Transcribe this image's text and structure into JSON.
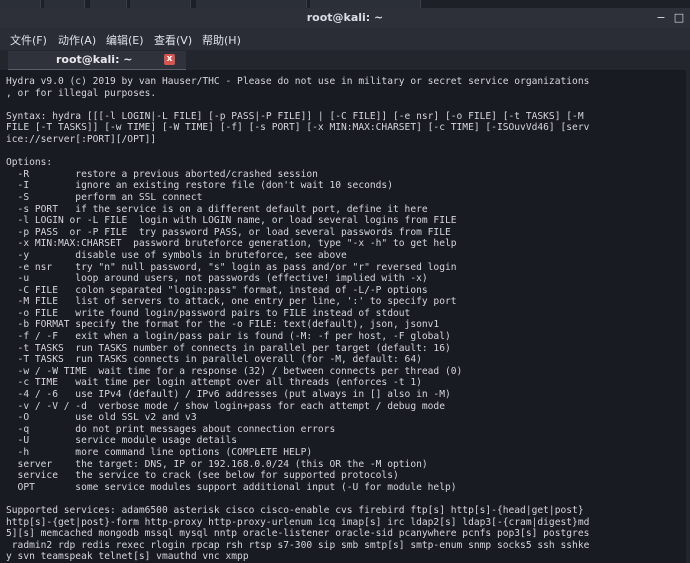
{
  "window": {
    "title": "root@kali: ~",
    "minimize_glyph": "−",
    "maximize_glyph": "□"
  },
  "menu": {
    "file": "文件(F)",
    "actions": "动作(A)",
    "edit": "编辑(E)",
    "view": "查看(V)",
    "help": "帮助(H)"
  },
  "tab": {
    "label": "root@kali: ~",
    "close_glyph": "x"
  },
  "terminal": {
    "text": "Hydra v9.0 (c) 2019 by van Hauser/THC - Please do not use in military or secret service organizations\n, or for illegal purposes.\n\nSyntax: hydra [[[-l LOGIN|-L FILE] [-p PASS|-P FILE]] | [-C FILE]] [-e nsr] [-o FILE] [-t TASKS] [-M\nFILE [-T TASKS]] [-w TIME] [-W TIME] [-f] [-s PORT] [-x MIN:MAX:CHARSET] [-c TIME] [-ISOuvVd46] [serv\nice://server[:PORT][/OPT]]\n\nOptions:\n  -R        restore a previous aborted/crashed session\n  -I        ignore an existing restore file (don't wait 10 seconds)\n  -S        perform an SSL connect\n  -s PORT   if the service is on a different default port, define it here\n  -l LOGIN or -L FILE  login with LOGIN name, or load several logins from FILE\n  -p PASS  or -P FILE  try password PASS, or load several passwords from FILE\n  -x MIN:MAX:CHARSET  password bruteforce generation, type \"-x -h\" to get help\n  -y        disable use of symbols in bruteforce, see above\n  -e nsr    try \"n\" null password, \"s\" login as pass and/or \"r\" reversed login\n  -u        loop around users, not passwords (effective! implied with -x)\n  -C FILE   colon separated \"login:pass\" format, instead of -L/-P options\n  -M FILE   list of servers to attack, one entry per line, ':' to specify port\n  -o FILE   write found login/password pairs to FILE instead of stdout\n  -b FORMAT specify the format for the -o FILE: text(default), json, jsonv1\n  -f / -F   exit when a login/pass pair is found (-M: -f per host, -F global)\n  -t TASKS  run TASKS number of connects in parallel per target (default: 16)\n  -T TASKS  run TASKS connects in parallel overall (for -M, default: 64)\n  -w / -W TIME  wait time for a response (32) / between connects per thread (0)\n  -c TIME   wait time per login attempt over all threads (enforces -t 1)\n  -4 / -6   use IPv4 (default) / IPv6 addresses (put always in [] also in -M)\n  -v / -V / -d  verbose mode / show login+pass for each attempt / debug mode\n  -O        use old SSL v2 and v3\n  -q        do not print messages about connection errors\n  -U        service module usage details\n  -h        more command line options (COMPLETE HELP)\n  server    the target: DNS, IP or 192.168.0.0/24 (this OR the -M option)\n  service   the service to crack (see below for supported protocols)\n  OPT       some service modules support additional input (-U for module help)\n\nSupported services: adam6500 asterisk cisco cisco-enable cvs firebird ftp[s] http[s]-{head|get|post}\nhttp[s]-{get|post}-form http-proxy http-proxy-urlenum icq imap[s] irc ldap2[s] ldap3[-{cram|digest}md\n5][s] memcached mongodb mssql mysql nntp oracle-listener oracle-sid pcanywhere pcnfs pop3[s] postgres\n radmin2 rdp redis rexec rlogin rpcap rsh rtsp s7-300 sip smb smtp[s] smtp-enum snmp socks5 ssh sshke\ny svn teamspeak telnet[s] vmauthd vnc xmpp"
  },
  "colors": {
    "terminal_bg": "#191b22",
    "text": "#d4d6dc",
    "tab_close": "#d9534f"
  }
}
